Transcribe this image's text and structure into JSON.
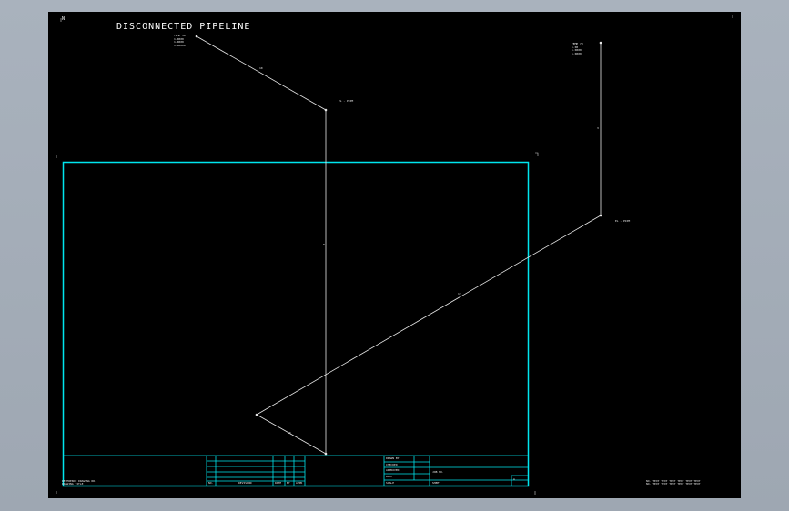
{
  "drawing": {
    "title": "DISCONNECTED PIPELINE",
    "corner_mark": "N"
  },
  "annotations": {
    "top_left_note": [
      "TEMP 50",
      "1.0000",
      "1.0000",
      "1.00000"
    ],
    "top_right_note": [
      "TEMP 70",
      "1.00",
      "1.0000",
      "1.0000"
    ],
    "elbow_1_tag": "EL - PIPE",
    "elbow_2_tag": "EL - PIPE",
    "seg_diag_top": "10",
    "seg_vertical_long": "8",
    "seg_vertical_right": "3",
    "seg_long_diag": "12",
    "seg_short_diag": "10"
  },
  "title_block": {
    "rev_label": "NO.",
    "rev_desc": "REVISION",
    "rev_date": "DATE",
    "rev_by": "BY",
    "rev_appr": "APPR",
    "drawn_by": "DRAWN BY",
    "checked": "CHECKED",
    "approved": "APPROVED",
    "date": "DATE",
    "scale": "SCALE",
    "job_no": "JOB NO.",
    "sheet": "SHEET",
    "size": "A"
  },
  "footer": {
    "left_notes": [
      "REFERENCE DRAWING NO.",
      "DRAWING TITLE"
    ],
    "right_notes": [
      "NO. TEXT TEXT TEXT TEXT TEXT TEXT",
      "NO. TEXT TEXT TEXT TEXT TEXT TEXT"
    ]
  }
}
